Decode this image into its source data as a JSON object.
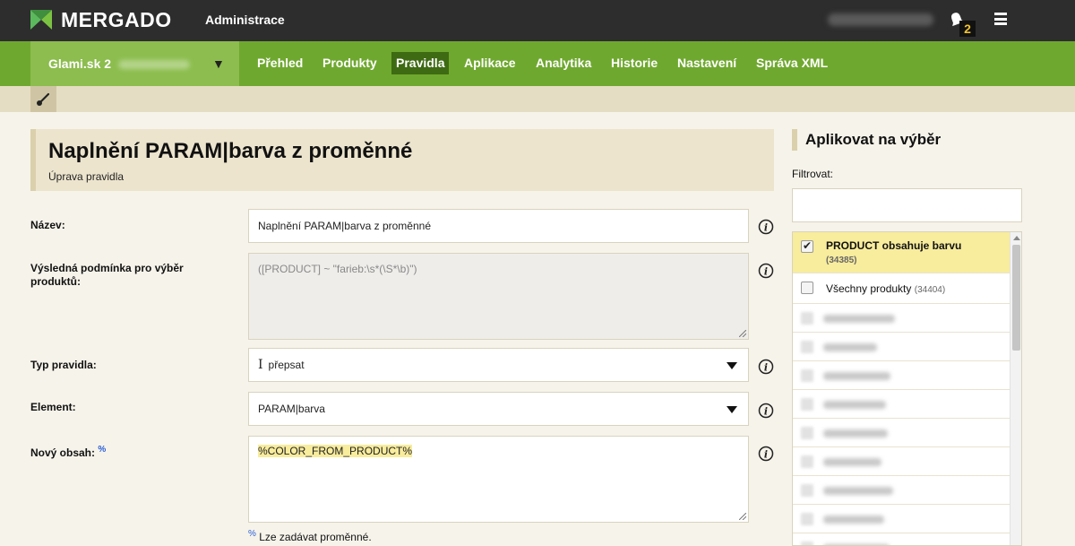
{
  "topbar": {
    "brand": "MERGADO",
    "section": "Administrace",
    "notification_count": "2"
  },
  "nav": {
    "shop_name": "Glami.sk 2",
    "items": [
      "Přehled",
      "Produkty",
      "Pravidla",
      "Aplikace",
      "Analytika",
      "Historie",
      "Nastavení",
      "Správa XML"
    ],
    "active": "Pravidla"
  },
  "page": {
    "title": "Naplnění PARAM|barva z proměnné",
    "subtitle": "Úprava pravidla"
  },
  "form": {
    "name_label": "Název:",
    "name_value": "Naplnění PARAM|barva z proměnné",
    "condition_label": "Výsledná podmínka pro výběr produktů:",
    "condition_value": "([PRODUCT] ~ \"farieb:\\s*(\\S*\\b)\")",
    "type_label": "Typ pravidla:",
    "type_value": "přepsat",
    "type_icon": "text-cursor-icon",
    "element_label": "Element:",
    "element_value": "PARAM|barva",
    "content_label": "Nový obsah:",
    "content_marker": "%",
    "content_value": "%COLOR_FROM_PRODUCT%",
    "hint_marker": "%",
    "hint_text": "Lze zadávat proměnné."
  },
  "panel": {
    "title": "Aplikovat na výběr",
    "filter_label": "Filtrovat:",
    "filter_value": "",
    "items": [
      {
        "label": "PRODUCT obsahuje barvu",
        "count": "(34385)",
        "checked": true
      },
      {
        "label": "Všechny produkty",
        "count": "(34404)",
        "checked": false
      }
    ]
  },
  "colors": {
    "topbar": "#2d2d2d",
    "nav_green": "#6fa82f",
    "nav_active": "#3e6a13",
    "highlight": "#f8ec9d",
    "background": "#f6f3ea"
  }
}
